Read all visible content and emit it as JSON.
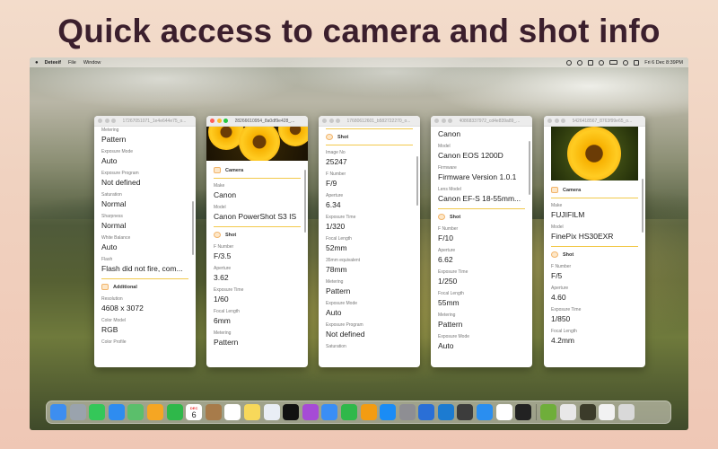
{
  "headline": "Quick access to camera and shot info",
  "menubar": {
    "app": "Deteeif",
    "items": [
      "File",
      "Window"
    ],
    "clock": "Fri 6 Dec  8:39PM"
  },
  "windows": [
    {
      "title": "17267051071_1e4e644e75_o...",
      "fields": [
        {
          "label": "Metering",
          "value": "Pattern"
        },
        {
          "label": "Exposure Mode",
          "value": "Auto"
        },
        {
          "label": "Exposure Program",
          "value": "Not defined"
        },
        {
          "label": "Saturation",
          "value": "Normal"
        },
        {
          "label": "Sharpness",
          "value": "Normal"
        },
        {
          "label": "White Balance",
          "value": "Auto"
        },
        {
          "label": "Flash",
          "value": "Flash did not fire, com..."
        }
      ],
      "section": "Additional",
      "fields2": [
        {
          "label": "Resolution",
          "value": "4608 x 3072"
        },
        {
          "label": "Color Model",
          "value": "RGB"
        },
        {
          "label": "Color Profile",
          "value": ""
        }
      ]
    },
    {
      "title": "28266610954_8a0df9e428_...",
      "section1": "Camera",
      "fields": [
        {
          "label": "Make",
          "value": "Canon"
        },
        {
          "label": "Model",
          "value": "Canon PowerShot S3 IS"
        }
      ],
      "section2": "Shot",
      "fields2": [
        {
          "label": "F Number",
          "value": "F/3.5"
        },
        {
          "label": "Aperture",
          "value": "3.62"
        },
        {
          "label": "Exposure Time",
          "value": "1/60"
        },
        {
          "label": "Focal Length",
          "value": "6mm"
        },
        {
          "label": "Metering",
          "value": "Pattern"
        }
      ]
    },
    {
      "title": "17680612601_b582722270_o...",
      "section": "Shot",
      "fields": [
        {
          "label": "Image No",
          "value": "25247"
        },
        {
          "label": "F Number",
          "value": "F/9"
        },
        {
          "label": "Aperture",
          "value": "6.34"
        },
        {
          "label": "Exposure Time",
          "value": "1/320"
        },
        {
          "label": "Focal Length",
          "value": "52mm"
        },
        {
          "label": "35mm equivalent",
          "value": "78mm"
        },
        {
          "label": "Metering",
          "value": "Pattern"
        },
        {
          "label": "Exposure Mode",
          "value": "Auto"
        },
        {
          "label": "Exposure Program",
          "value": "Not defined"
        },
        {
          "label": "Saturation",
          "value": ""
        }
      ]
    },
    {
      "title": "40868337972_cd4e839a89_...",
      "fields": [
        {
          "label": "",
          "value": "Canon"
        },
        {
          "label": "Model",
          "value": "Canon EOS 1200D"
        },
        {
          "label": "Firmware",
          "value": "Firmware Version 1.0.1"
        },
        {
          "label": "Lens Model",
          "value": "Canon EF-S 18-55mm..."
        }
      ],
      "section": "Shot",
      "fields2": [
        {
          "label": "F Number",
          "value": "F/10"
        },
        {
          "label": "Aperture",
          "value": "6.62"
        },
        {
          "label": "Exposure Time",
          "value": "1/250"
        },
        {
          "label": "Focal Length",
          "value": "55mm"
        },
        {
          "label": "Metering",
          "value": "Pattern"
        },
        {
          "label": "Exposure Mode",
          "value": "Auto"
        }
      ]
    },
    {
      "title": "5426418567_8763f99e65_o...",
      "section1": "Camera",
      "fields": [
        {
          "label": "Make",
          "value": "FUJIFILM"
        },
        {
          "label": "Model",
          "value": "FinePix HS30EXR"
        }
      ],
      "section2": "Shot",
      "fields2": [
        {
          "label": "F Number",
          "value": "F/5"
        },
        {
          "label": "Aperture",
          "value": "4.60"
        },
        {
          "label": "Exposure Time",
          "value": "1/850"
        },
        {
          "label": "Focal Length",
          "value": "4.2mm"
        },
        {
          "label": "Metering",
          "value": ""
        }
      ]
    }
  ],
  "calendar": {
    "month": "DEC",
    "day": "6"
  },
  "dock": [
    {
      "name": "finder-icon",
      "color": "#3d8ef0"
    },
    {
      "name": "launchpad-icon",
      "color": "#9aa3ad"
    },
    {
      "name": "messages-icon",
      "color": "#34c759"
    },
    {
      "name": "mail-icon",
      "color": "#2e8cf0"
    },
    {
      "name": "maps-icon",
      "color": "#5bbf6b"
    },
    {
      "name": "photos-icon",
      "color": "#f5a623"
    },
    {
      "name": "facetime-icon",
      "color": "#2fb84a"
    },
    {
      "name": "calendar-icon",
      "color": "#ffffff"
    },
    {
      "name": "contacts-icon",
      "color": "#a77b4a"
    },
    {
      "name": "reminders-icon",
      "color": "#ffffff"
    },
    {
      "name": "notes-icon",
      "color": "#f7d85a"
    },
    {
      "name": "freeform-icon",
      "color": "#e9eef5"
    },
    {
      "name": "tv-icon",
      "color": "#111111"
    },
    {
      "name": "podcasts-icon",
      "color": "#a64bd6"
    },
    {
      "name": "keynote-icon",
      "color": "#3a8ef5"
    },
    {
      "name": "numbers-icon",
      "color": "#2fb84a"
    },
    {
      "name": "pages-icon",
      "color": "#f39c12"
    },
    {
      "name": "appstore-icon",
      "color": "#1a8cf5"
    },
    {
      "name": "settings-icon",
      "color": "#8e8e93"
    },
    {
      "name": "xcode-icon",
      "color": "#2a6fd6"
    },
    {
      "name": "vscode-icon",
      "color": "#1c7bd1"
    },
    {
      "name": "calculator-icon",
      "color": "#3c3c3c"
    },
    {
      "name": "safari-icon",
      "color": "#2a8ef0"
    },
    {
      "name": "gmail-icon",
      "color": "#ffffff"
    },
    {
      "name": "terminal-icon",
      "color": "#222222"
    },
    {
      "name": "editor-icon",
      "color": "#6fae3a"
    },
    {
      "name": "preview-icon",
      "color": "#e8e8e8"
    },
    {
      "name": "aperture-icon",
      "color": "#3b3b2a"
    },
    {
      "name": "document-icon",
      "color": "#f2f2f2"
    },
    {
      "name": "trash-icon",
      "color": "#d9d9d9"
    }
  ]
}
